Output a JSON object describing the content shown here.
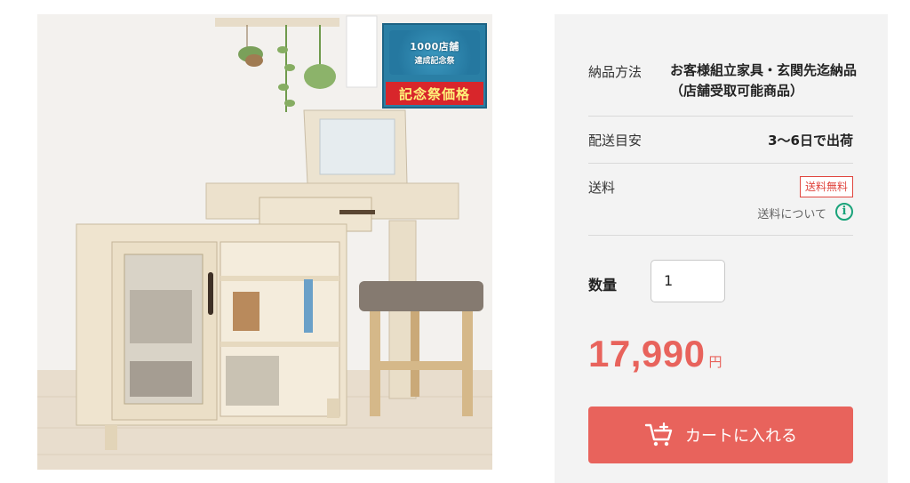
{
  "product": {
    "image_alt": "",
    "badge": {
      "line1": "1000店舗",
      "line2": "達成記念祭",
      "banner": "記念祭価格"
    }
  },
  "details": {
    "delivery_method_label": "納品方法",
    "delivery_method_value": "お客様組立家具・玄関先迄納品（店舗受取可能商品）",
    "eta_label": "配送目安",
    "eta_value": "3〜6日で出荷",
    "shipping_label": "送料",
    "shipping_badge": "送料無料",
    "shipping_link": "送料について",
    "info_icon": "i"
  },
  "quantity": {
    "label": "数量",
    "value": "1"
  },
  "price": {
    "amount": "17,990",
    "unit": "円"
  },
  "cart": {
    "label": "カートに入れる",
    "icon": "cart-add-icon"
  },
  "colors": {
    "accent": "#e8635c",
    "info_icon": "#1aa37a",
    "panel_bg": "#f3f3f3"
  }
}
